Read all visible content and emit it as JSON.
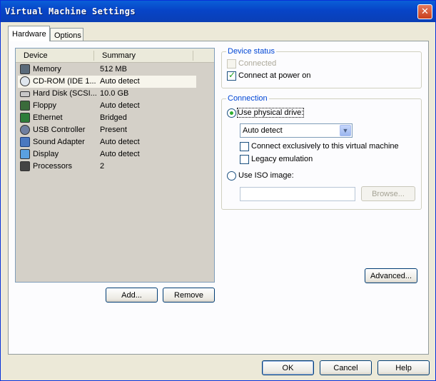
{
  "window": {
    "title": "Virtual Machine Settings",
    "close_label": "✕"
  },
  "tabs": [
    {
      "label": "Hardware",
      "active": true
    },
    {
      "label": "Options",
      "active": false
    }
  ],
  "device_list": {
    "columns": [
      "Device",
      "Summary"
    ],
    "rows": [
      {
        "icon": "memory-icon",
        "name": "Memory",
        "summary": "512 MB",
        "selected": false
      },
      {
        "icon": "cdrom-icon",
        "name": "CD-ROM (IDE 1...",
        "summary": "Auto detect",
        "selected": true
      },
      {
        "icon": "hard-disk-icon",
        "name": "Hard Disk (SCSI...",
        "summary": "10.0 GB",
        "selected": false
      },
      {
        "icon": "floppy-icon",
        "name": "Floppy",
        "summary": "Auto detect",
        "selected": false
      },
      {
        "icon": "ethernet-icon",
        "name": "Ethernet",
        "summary": "Bridged",
        "selected": false
      },
      {
        "icon": "usb-icon",
        "name": "USB Controller",
        "summary": "Present",
        "selected": false
      },
      {
        "icon": "sound-icon",
        "name": "Sound Adapter",
        "summary": "Auto detect",
        "selected": false
      },
      {
        "icon": "display-icon",
        "name": "Display",
        "summary": "Auto detect",
        "selected": false
      },
      {
        "icon": "processor-icon",
        "name": "Processors",
        "summary": "2",
        "selected": false
      }
    ]
  },
  "list_buttons": {
    "add": "Add...",
    "remove": "Remove"
  },
  "device_status": {
    "title": "Device status",
    "connected": {
      "label": "Connected",
      "checked": false,
      "enabled": false
    },
    "connect_at_power_on": {
      "label": "Connect at power on",
      "checked": true,
      "enabled": true
    }
  },
  "connection": {
    "title": "Connection",
    "use_physical_drive": {
      "label": "Use physical drive:",
      "selected": true
    },
    "drive_select": {
      "value": "Auto detect"
    },
    "connect_exclusively": {
      "label": "Connect exclusively to this virtual machine",
      "checked": false
    },
    "legacy_emulation": {
      "label": "Legacy emulation",
      "checked": false
    },
    "use_iso_image": {
      "label": "Use ISO image:",
      "selected": false
    },
    "iso_path": {
      "value": ""
    },
    "browse": "Browse..."
  },
  "advanced_button": "Advanced...",
  "footer": {
    "ok": "OK",
    "cancel": "Cancel",
    "help": "Help"
  }
}
